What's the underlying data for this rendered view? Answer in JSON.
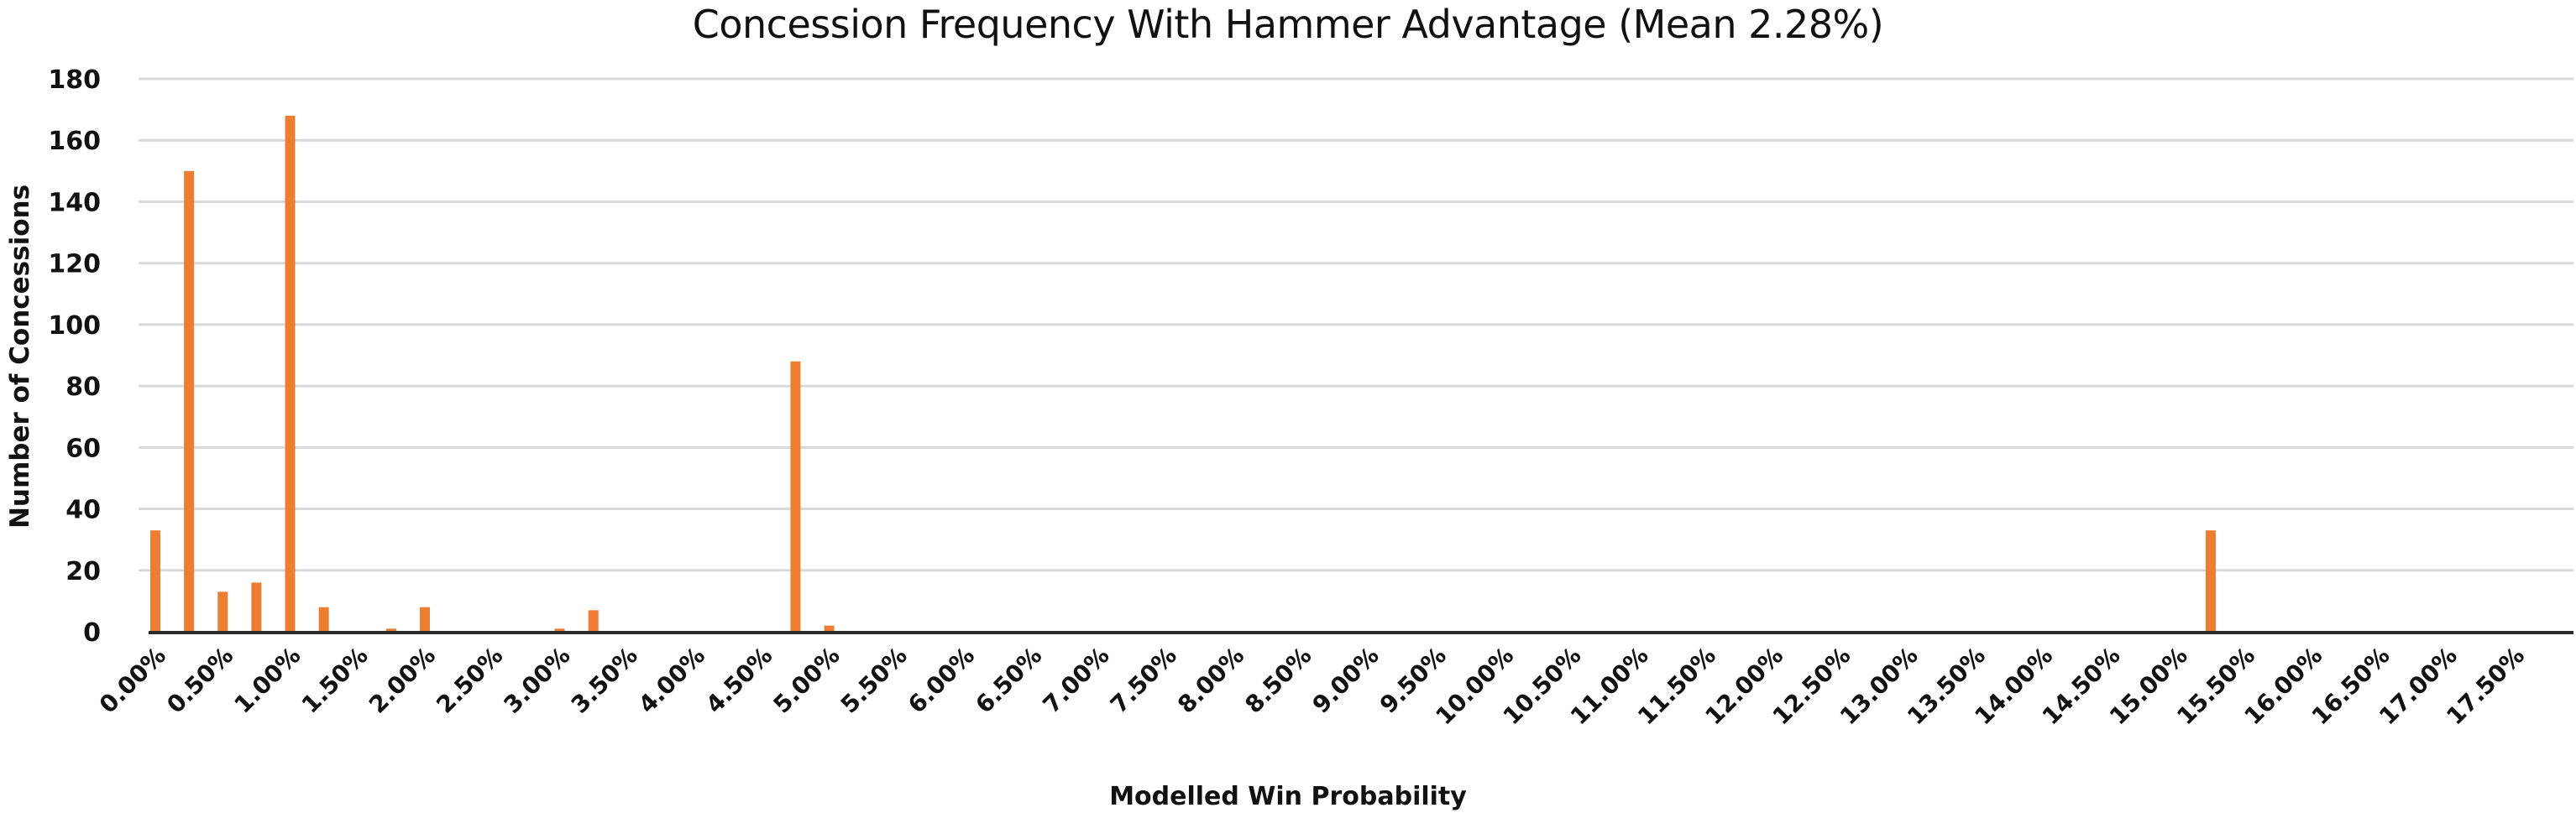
{
  "chart_data": {
    "type": "bar",
    "title": "Concession Frequency With Hammer Advantage (Mean 2.28%)",
    "xlabel": "Modelled Win Probability",
    "ylabel": "Number  of Concessions",
    "ylim": [
      0,
      180
    ],
    "yticks": [
      0,
      20,
      40,
      60,
      80,
      100,
      120,
      140,
      160,
      180
    ],
    "grid": true,
    "legend": "none",
    "bar_color": "#ED7D31",
    "category_step_percent": 0.25,
    "category_count": 72,
    "xtick_labels": [
      "0.00%",
      "0.50%",
      "1.00%",
      "1.50%",
      "2.00%",
      "2.50%",
      "3.00%",
      "3.50%",
      "4.00%",
      "4.50%",
      "5.00%",
      "5.50%",
      "6.00%",
      "6.50%",
      "7.00%",
      "7.50%",
      "8.00%",
      "8.50%",
      "9.00%",
      "9.50%",
      "10.00%",
      "10.50%",
      "11.00%",
      "11.50%",
      "12.00%",
      "12.50%",
      "13.00%",
      "13.50%",
      "14.00%",
      "14.50%",
      "15.00%",
      "15.50%",
      "16.00%",
      "16.50%",
      "17.00%",
      "17.50%"
    ],
    "bars": [
      {
        "x": "0.00%",
        "value": 33
      },
      {
        "x": "0.25%",
        "value": 150
      },
      {
        "x": "0.50%",
        "value": 13
      },
      {
        "x": "0.75%",
        "value": 16
      },
      {
        "x": "1.00%",
        "value": 168
      },
      {
        "x": "1.25%",
        "value": 8
      },
      {
        "x": "1.75%",
        "value": 1
      },
      {
        "x": "2.00%",
        "value": 8
      },
      {
        "x": "3.00%",
        "value": 1
      },
      {
        "x": "3.25%",
        "value": 7
      },
      {
        "x": "4.75%",
        "value": 88
      },
      {
        "x": "5.00%",
        "value": 2
      },
      {
        "x": "15.25%",
        "value": 33
      }
    ]
  }
}
